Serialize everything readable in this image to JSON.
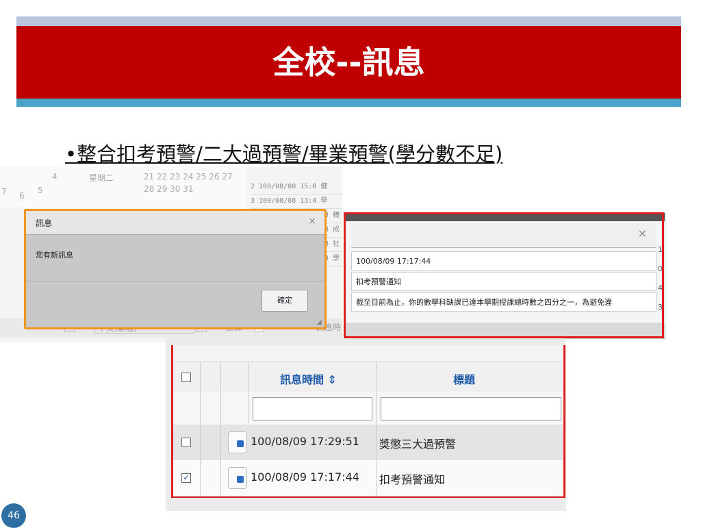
{
  "slide": {
    "title": "全校--訊息",
    "bullet": "•整合扣考預警/二大過預警/畢業預警(學分數不足)",
    "page_number": "46"
  },
  "screenshot1": {
    "calendar_text": [
      "7",
      "6",
      "5",
      "4",
      "星期二",
      "21 22 23 24 25 26 27",
      "28 29 30 31"
    ],
    "background_rows": [
      "2  100/08/08 15:0 健",
      "3  100/08/08 13:4 學",
      "3 轉",
      "3 成",
      "3 社",
      "3 學"
    ],
    "bottom_lang": "中文(繁體)",
    "bottom_translate": "翻譯",
    "bottom_msgtime": "訊息時",
    "dialog": {
      "title": "訊息",
      "close": "×",
      "message": "您有新訊息",
      "confirm": "確定"
    }
  },
  "screenshot2": {
    "close": "×",
    "rows": [
      "100/08/09 17:17:44",
      "扣考預警通知",
      "截至目前為止，你的數學科缺課已達本學期授課總時數之四分之一，為避免違"
    ],
    "side_numbers": [
      "1",
      "0",
      "4",
      "3",
      "3"
    ]
  },
  "screenshot3": {
    "headers": {
      "time": "訊息時間 ⇕",
      "title": "標題"
    },
    "rows": [
      {
        "checked": false,
        "time": "100/08/09 17:29:51",
        "title": "獎懲三大過預警"
      },
      {
        "checked": true,
        "time": "100/08/09 17:17:44",
        "title": "扣考預警通知"
      }
    ]
  },
  "colors": {
    "title_band": "#c00000",
    "accent_teal": "#4aa3c8",
    "highlight_orange": "#f0961e",
    "highlight_red": "#e02020"
  }
}
